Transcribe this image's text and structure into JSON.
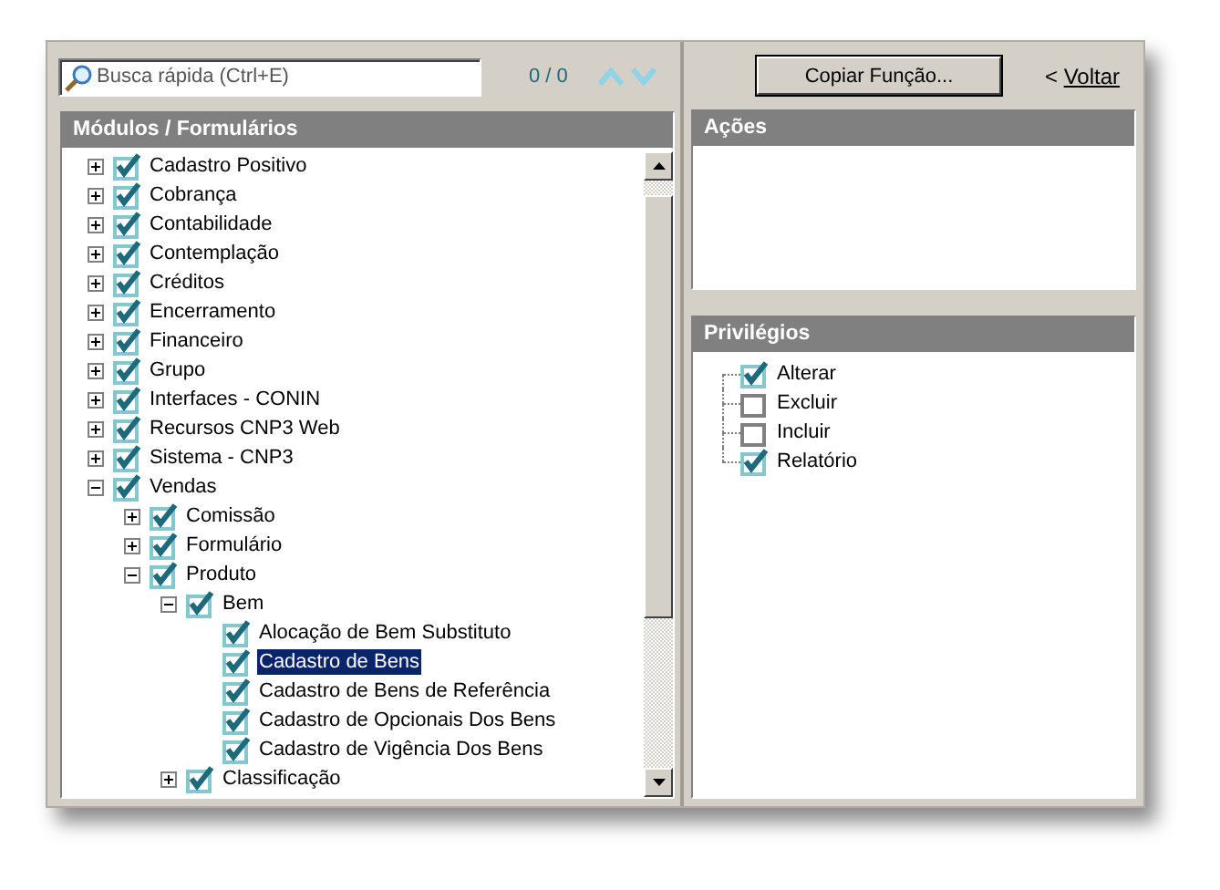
{
  "search": {
    "placeholder": "Busca rápida (Ctrl+E)",
    "count": "0 / 0"
  },
  "modules": {
    "title": "Módulos / Formulários",
    "items": [
      {
        "label": "Cadastro Positivo",
        "checked": true,
        "expanded": false,
        "selected": false
      },
      {
        "label": "Cobrança",
        "checked": true,
        "expanded": false,
        "selected": false
      },
      {
        "label": "Contabilidade",
        "checked": true,
        "expanded": false,
        "selected": false
      },
      {
        "label": "Contemplação",
        "checked": true,
        "expanded": false,
        "selected": false
      },
      {
        "label": "Créditos",
        "checked": true,
        "expanded": false,
        "selected": false
      },
      {
        "label": "Encerramento",
        "checked": true,
        "expanded": false,
        "selected": false
      },
      {
        "label": "Financeiro",
        "checked": true,
        "expanded": false,
        "selected": false
      },
      {
        "label": "Grupo",
        "checked": true,
        "expanded": false,
        "selected": false
      },
      {
        "label": "Interfaces - CONIN",
        "checked": true,
        "expanded": false,
        "selected": false
      },
      {
        "label": "Recursos CNP3 Web",
        "checked": true,
        "expanded": false,
        "selected": false
      },
      {
        "label": "Sistema - CNP3",
        "checked": true,
        "expanded": false,
        "selected": false
      },
      {
        "label": "Vendas",
        "checked": true,
        "expanded": true,
        "selected": false,
        "children": [
          {
            "label": "Comissão",
            "checked": true,
            "expanded": false,
            "selected": false
          },
          {
            "label": "Formulário",
            "checked": true,
            "expanded": false,
            "selected": false
          },
          {
            "label": "Produto",
            "checked": true,
            "expanded": true,
            "selected": false,
            "children": [
              {
                "label": "Bem",
                "checked": true,
                "expanded": true,
                "selected": false,
                "children": [
                  {
                    "label": "Alocação de Bem Substituto",
                    "checked": true,
                    "selected": false
                  },
                  {
                    "label": "Cadastro de Bens",
                    "checked": true,
                    "selected": true
                  },
                  {
                    "label": "Cadastro de Bens de Referência",
                    "checked": true,
                    "selected": false
                  },
                  {
                    "label": "Cadastro de Opcionais Dos Bens",
                    "checked": true,
                    "selected": false
                  },
                  {
                    "label": "Cadastro de Vigência Dos Bens",
                    "checked": true,
                    "selected": false
                  }
                ]
              },
              {
                "label": "Classificação",
                "checked": true,
                "expanded": false,
                "selected": false
              }
            ]
          }
        ]
      }
    ]
  },
  "copy_button": "Copiar Função...",
  "back_link": {
    "arrow": "<",
    "label": "Voltar"
  },
  "actions": {
    "title": "Ações"
  },
  "privileges": {
    "title": "Privilégios",
    "items": [
      {
        "label": "Alterar",
        "checked": true
      },
      {
        "label": "Excluir",
        "checked": false
      },
      {
        "label": "Incluir",
        "checked": false
      },
      {
        "label": "Relatório",
        "checked": true
      }
    ]
  }
}
